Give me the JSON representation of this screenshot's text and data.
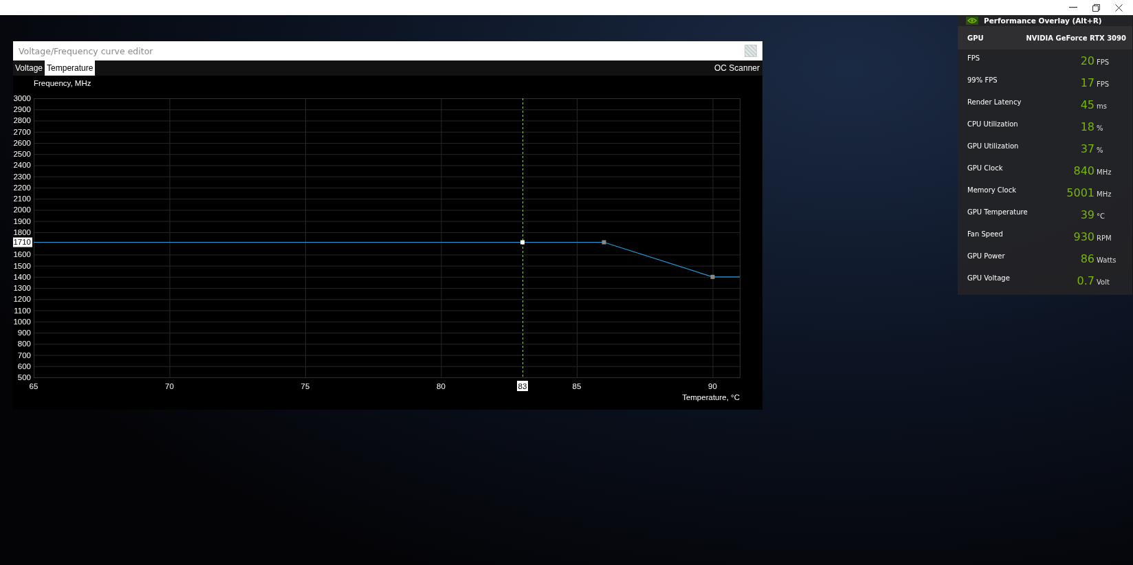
{
  "editor": {
    "title": "Voltage/Frequency curve editor",
    "tabs": [
      {
        "label": "Voltage",
        "selected": false
      },
      {
        "label": "Temperature",
        "selected": true
      }
    ],
    "action": "OC Scanner",
    "chart_data": {
      "type": "line",
      "xlabel": "Temperature, °C",
      "ylabel": "Frequency, MHz",
      "x": [
        65,
        83,
        86,
        90,
        91
      ],
      "series": [
        {
          "color": "#1e9fe0",
          "values": [
            1710,
            1710,
            1710,
            1400,
            1400
          ]
        }
      ],
      "grid": true,
      "xlim": [
        65,
        91
      ],
      "ylim": [
        500,
        3000
      ],
      "xticks": [
        65,
        70,
        75,
        80,
        {
          "value": 83,
          "label": "83"
        },
        85,
        90
      ],
      "yticks": [
        500,
        600,
        700,
        800,
        900,
        1000,
        1100,
        1200,
        1300,
        1400,
        1500,
        1600,
        {
          "value": 1710,
          "label": "1710"
        },
        1800,
        1900,
        2000,
        2100,
        2200,
        2300,
        2400,
        2500,
        2600,
        2700,
        2800,
        2900,
        3000
      ],
      "ref_lines": [
        {
          "axis": "x",
          "value": 83,
          "color": "#8fd43a"
        }
      ]
    }
  },
  "overlay": {
    "title": "Performance Overlay (Alt+R)",
    "gpu": {
      "label": "GPU",
      "value": "NVIDIA GeForce RTX 3090"
    },
    "metrics": [
      {
        "label": "FPS",
        "value": "20",
        "unit": "FPS"
      },
      {
        "label": "99% FPS",
        "value": "17",
        "unit": "FPS"
      },
      {
        "label": "Render Latency",
        "value": "45",
        "unit": "ms"
      },
      {
        "label": "CPU Utilization",
        "value": "18",
        "unit": "%"
      },
      {
        "label": "GPU Utilization",
        "value": "37",
        "unit": "%"
      },
      {
        "label": "GPU Clock",
        "value": "840",
        "unit": "MHz"
      },
      {
        "label": "Memory Clock",
        "value": "5001",
        "unit": "MHz"
      },
      {
        "label": "GPU Temperature",
        "value": "39",
        "unit": "°C"
      },
      {
        "label": "Fan Speed",
        "value": "930",
        "unit": "RPM"
      },
      {
        "label": "GPU Power",
        "value": "86",
        "unit": "Watts"
      },
      {
        "label": "GPU Voltage",
        "value": "0.7",
        "unit": "Volt"
      }
    ]
  }
}
